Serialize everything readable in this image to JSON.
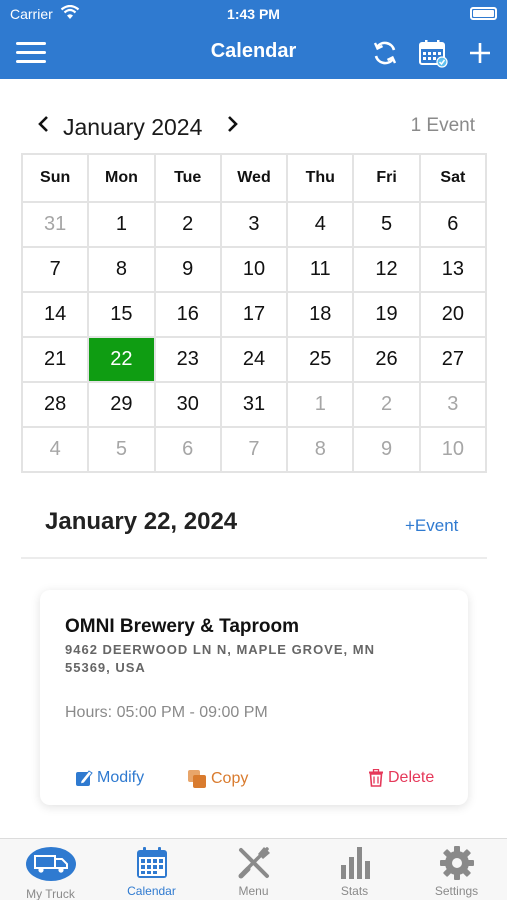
{
  "status_bar": {
    "carrier": "Carrier",
    "time": "1:43 PM"
  },
  "navbar": {
    "title": "Calendar"
  },
  "month_header": {
    "label": "January 2024",
    "event_count": "1 Event"
  },
  "calendar": {
    "weekdays": [
      "Sun",
      "Mon",
      "Tue",
      "Wed",
      "Thu",
      "Fri",
      "Sat"
    ],
    "weeks": [
      [
        "31",
        "1",
        "2",
        "3",
        "4",
        "5",
        "6"
      ],
      [
        "7",
        "8",
        "9",
        "10",
        "11",
        "12",
        "13"
      ],
      [
        "14",
        "15",
        "16",
        "17",
        "18",
        "19",
        "20"
      ],
      [
        "21",
        "22",
        "23",
        "24",
        "25",
        "26",
        "27"
      ],
      [
        "28",
        "29",
        "30",
        "31",
        "1",
        "2",
        "3"
      ],
      [
        "4",
        "5",
        "6",
        "7",
        "8",
        "9",
        "10"
      ]
    ],
    "selected_day": "22"
  },
  "selected_date": {
    "heading": "January 22, 2024",
    "add_event_label": "+Event"
  },
  "event": {
    "name": "OMNI Brewery & Taproom",
    "address": "9462 DEERWOOD LN N, MAPLE GROVE, MN 55369, USA",
    "hours": "Hours: 05:00 PM - 09:00 PM",
    "modify_label": "Modify",
    "copy_label": "Copy",
    "delete_label": "Delete"
  },
  "tabbar": {
    "tabs": [
      {
        "label": "My Truck",
        "icon": "truck-icon"
      },
      {
        "label": "Calendar",
        "icon": "calendar-icon"
      },
      {
        "label": "Menu",
        "icon": "utensils-icon"
      },
      {
        "label": "Stats",
        "icon": "stats-icon"
      },
      {
        "label": "Settings",
        "icon": "gear-icon"
      }
    ],
    "active": "Calendar"
  },
  "colors": {
    "brand_blue": "#2f7ad0",
    "selected_green": "#0f9d12",
    "copy_orange": "#d97b2e",
    "delete_red": "#e5395a"
  }
}
